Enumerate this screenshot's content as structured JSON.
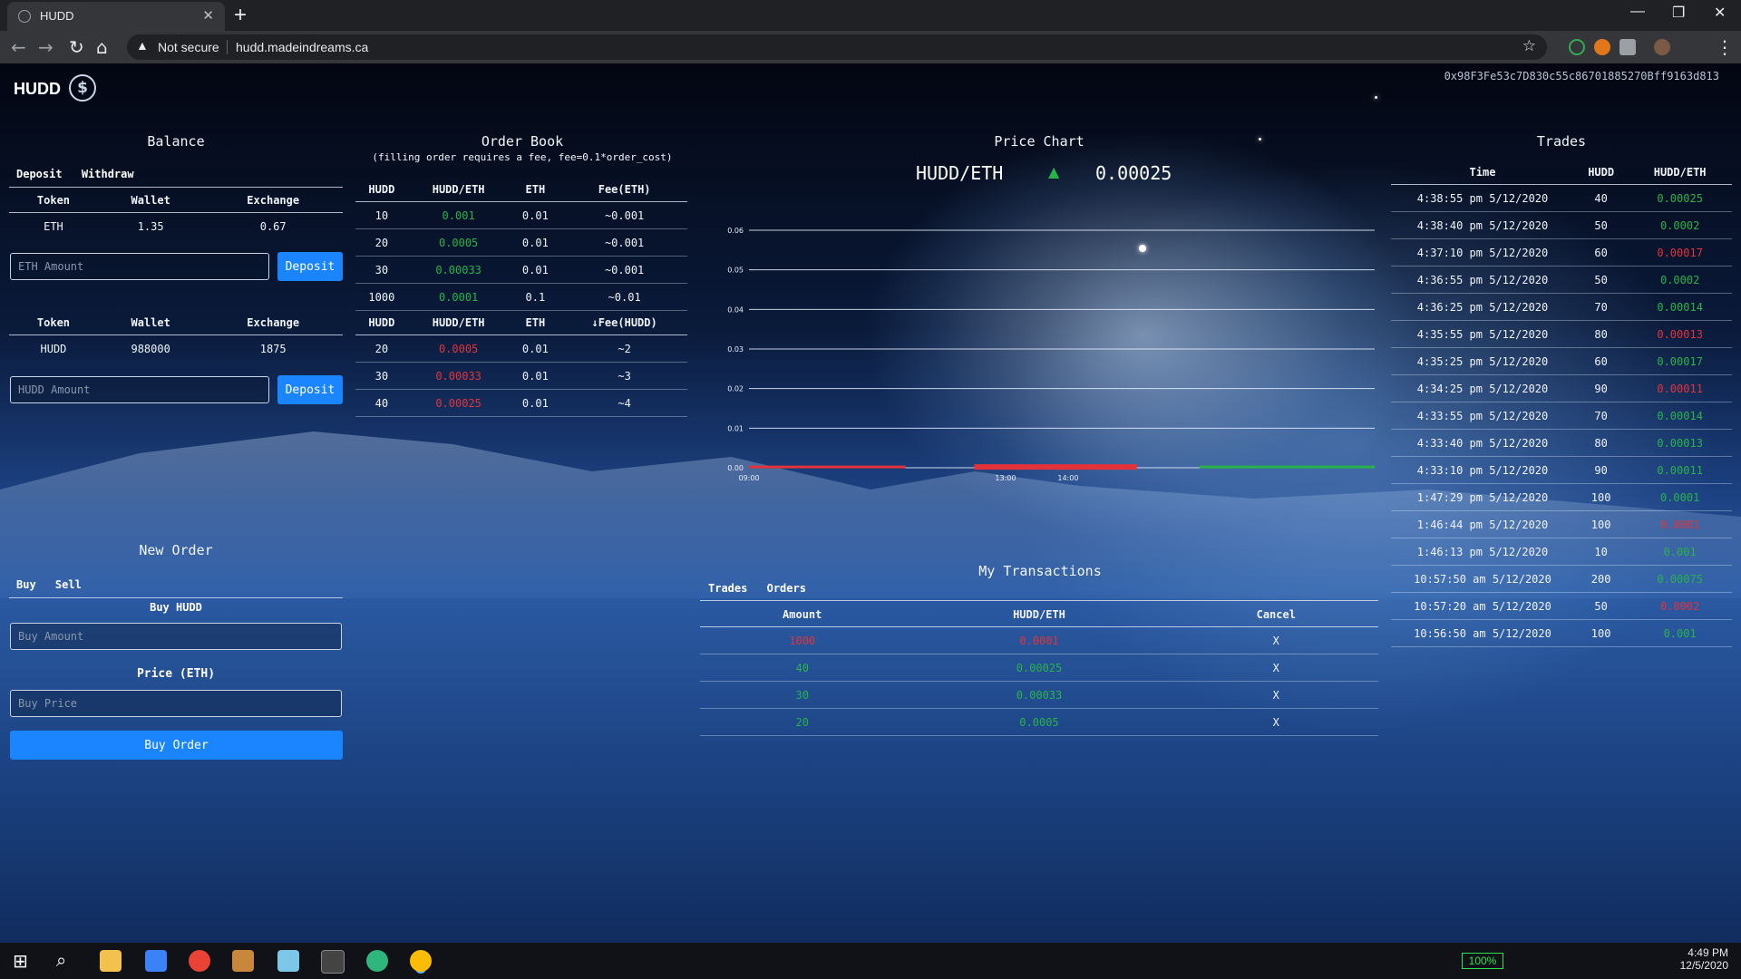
{
  "browser": {
    "tab_title": "HUDD",
    "not_secure": "Not secure",
    "url": "hudd.madeindreams.ca"
  },
  "app": {
    "brand": "HUDD",
    "account": "0x98F3Fe53c7D830c55c86701885270Bff9163d813"
  },
  "balance": {
    "title": "Balance",
    "tabs": [
      "Deposit",
      "Withdraw"
    ],
    "headers": [
      "Token",
      "Wallet",
      "Exchange"
    ],
    "eth_row": [
      "ETH",
      "1.35",
      "0.67"
    ],
    "eth_placeholder": "ETH Amount",
    "hudd_row": [
      "HUDD",
      "988000",
      "1875"
    ],
    "hudd_placeholder": "HUDD Amount",
    "deposit_label": "Deposit"
  },
  "new_order": {
    "title": "New Order",
    "tabs": [
      "Buy",
      "Sell"
    ],
    "buy_label": "Buy HUDD",
    "amount_placeholder": "Buy Amount",
    "price_label": "Price (ETH)",
    "price_placeholder": "Buy Price",
    "submit_label": "Buy Order"
  },
  "order_book": {
    "title": "Order Book",
    "subtitle": "(filling order requires a fee, fee=0.1*order_cost)",
    "sell_headers": [
      "HUDD",
      "HUDD/ETH",
      "ETH",
      "Fee(ETH)"
    ],
    "sell_rows": [
      [
        "10",
        "0.001",
        "0.01",
        "~0.001"
      ],
      [
        "20",
        "0.0005",
        "0.01",
        "~0.001"
      ],
      [
        "30",
        "0.00033",
        "0.01",
        "~0.001"
      ],
      [
        "1000",
        "0.0001",
        "0.1",
        "~0.01"
      ]
    ],
    "buy_headers": [
      "HUDD",
      "HUDD/ETH",
      "ETH",
      "↓Fee(HUDD)"
    ],
    "buy_rows": [
      [
        "20",
        "0.0005",
        "0.01",
        "~2"
      ],
      [
        "30",
        "0.00033",
        "0.01",
        "~3"
      ],
      [
        "40",
        "0.00025",
        "0.01",
        "~4"
      ]
    ]
  },
  "price_chart": {
    "title": "Price Chart",
    "pair": "HUDD/ETH",
    "direction_icon": "triangle-up-icon",
    "price": "0.00025"
  },
  "chart_data": {
    "type": "line",
    "title": "",
    "xlabel": "",
    "ylabel": "",
    "ylim": [
      0,
      0.06
    ],
    "y_ticks": [
      "0.06",
      "0.05",
      "0.04",
      "0.03",
      "0.02",
      "0.01",
      "0.00"
    ],
    "x_ticks": [
      "09:00",
      "13:00",
      "14:00"
    ],
    "segments": [
      {
        "color": "#e2333a",
        "x_start": 0.0,
        "x_end": 0.25,
        "y": 0.0002
      },
      {
        "color": "#e2333a",
        "x_start": 0.36,
        "x_end": 0.62,
        "y": 0.0002,
        "bold": true
      },
      {
        "color": "#28b34a",
        "x_start": 0.72,
        "x_end": 1.0,
        "y": 0.0002
      }
    ]
  },
  "trades": {
    "title": "Trades",
    "headers": [
      "Time",
      "HUDD",
      "HUDD/ETH"
    ],
    "rows": [
      {
        "time": "4:38:55 pm 5/12/2020",
        "hudd": "40",
        "price": "0.00025",
        "side": "buy"
      },
      {
        "time": "4:38:40 pm 5/12/2020",
        "hudd": "50",
        "price": "0.0002",
        "side": "buy"
      },
      {
        "time": "4:37:10 pm 5/12/2020",
        "hudd": "60",
        "price": "0.00017",
        "side": "sell"
      },
      {
        "time": "4:36:55 pm 5/12/2020",
        "hudd": "50",
        "price": "0.0002",
        "side": "buy"
      },
      {
        "time": "4:36:25 pm 5/12/2020",
        "hudd": "70",
        "price": "0.00014",
        "side": "buy"
      },
      {
        "time": "4:35:55 pm 5/12/2020",
        "hudd": "80",
        "price": "0.00013",
        "side": "sell"
      },
      {
        "time": "4:35:25 pm 5/12/2020",
        "hudd": "60",
        "price": "0.00017",
        "side": "buy"
      },
      {
        "time": "4:34:25 pm 5/12/2020",
        "hudd": "90",
        "price": "0.00011",
        "side": "sell"
      },
      {
        "time": "4:33:55 pm 5/12/2020",
        "hudd": "70",
        "price": "0.00014",
        "side": "buy"
      },
      {
        "time": "4:33:40 pm 5/12/2020",
        "hudd": "80",
        "price": "0.00013",
        "side": "buy"
      },
      {
        "time": "4:33:10 pm 5/12/2020",
        "hudd": "90",
        "price": "0.00011",
        "side": "buy"
      },
      {
        "time": "1:47:29 pm 5/12/2020",
        "hudd": "100",
        "price": "0.0001",
        "side": "buy"
      },
      {
        "time": "1:46:44 pm 5/12/2020",
        "hudd": "100",
        "price": "0.0001",
        "side": "sell"
      },
      {
        "time": "1:46:13 pm 5/12/2020",
        "hudd": "10",
        "price": "0.001",
        "side": "buy"
      },
      {
        "time": "10:57:50 am 5/12/2020",
        "hudd": "200",
        "price": "0.00075",
        "side": "buy"
      },
      {
        "time": "10:57:20 am 5/12/2020",
        "hudd": "50",
        "price": "0.0002",
        "side": "sell"
      },
      {
        "time": "10:56:50 am 5/12/2020",
        "hudd": "100",
        "price": "0.001",
        "side": "buy"
      }
    ]
  },
  "my_transactions": {
    "title": "My Transactions",
    "tabs": [
      "Trades",
      "Orders"
    ],
    "headers": [
      "Amount",
      "HUDD/ETH",
      "Cancel"
    ],
    "rows": [
      {
        "amount": "1000",
        "price": "0.0001",
        "cancel": "X",
        "side": "sell"
      },
      {
        "amount": "40",
        "price": "0.00025",
        "cancel": "X",
        "side": "buy"
      },
      {
        "amount": "30",
        "price": "0.00033",
        "cancel": "X",
        "side": "buy"
      },
      {
        "amount": "20",
        "price": "0.0005",
        "cancel": "X",
        "side": "buy"
      }
    ]
  },
  "taskbar": {
    "zoom": "100%",
    "time": "4:49 PM",
    "date": "12/5/2020"
  }
}
